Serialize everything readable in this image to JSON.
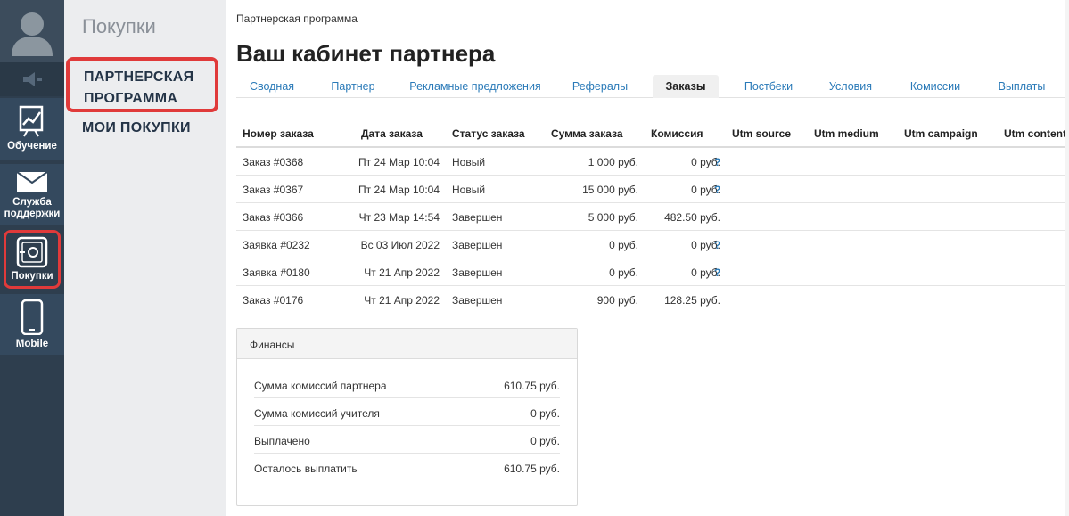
{
  "rail": {
    "learning_label": "Обучение",
    "support_label_1": "Служба",
    "support_label_2": "поддержки",
    "purchases_label": "Покупки",
    "mobile_label": "Mobile"
  },
  "subnav": {
    "title": "Покупки",
    "partner_line1": "ПАРТНЕРСКАЯ",
    "partner_line2": "ПРОГРАММА",
    "my_purchases": "МОИ ПОКУПКИ"
  },
  "main": {
    "breadcrumb": "Партнерская программа",
    "title": "Ваш кабинет партнера",
    "tabs": [
      {
        "label": "Сводная",
        "active": false
      },
      {
        "label": "Партнер",
        "active": false
      },
      {
        "label": "Рекламные предложения",
        "active": false
      },
      {
        "label": "Рефералы",
        "active": false
      },
      {
        "label": "Заказы",
        "active": true
      },
      {
        "label": "Постбеки",
        "active": false
      },
      {
        "label": "Условия",
        "active": false
      },
      {
        "label": "Комиссии",
        "active": false
      },
      {
        "label": "Выплаты",
        "active": false
      }
    ]
  },
  "orders": {
    "columns": [
      "Номер заказа",
      "Дата заказа",
      "Статус заказа",
      "Сумма заказа",
      "Комиссия",
      "Utm source",
      "Utm medium",
      "Utm campaign",
      "Utm content"
    ],
    "rows": [
      {
        "number": "Заказ #0368",
        "date": "Пт 24 Мар 10:04",
        "status": "Новый",
        "sum": "1 000 руб.",
        "commission": "0 руб.",
        "help": "?"
      },
      {
        "number": "Заказ #0367",
        "date": "Пт 24 Мар 10:04",
        "status": "Новый",
        "sum": "15 000 руб.",
        "commission": "0 руб.",
        "help": "?"
      },
      {
        "number": "Заказ #0366",
        "date": "Чт 23 Мар 14:54",
        "status": "Завершен",
        "sum": "5 000 руб.",
        "commission": "482.50 руб.",
        "help": ""
      },
      {
        "number": "Заявка #0232",
        "date": "Вс 03 Июл 2022",
        "status": "Завершен",
        "sum": "0 руб.",
        "commission": "0 руб.",
        "help": "?"
      },
      {
        "number": "Заявка #0180",
        "date": "Чт 21 Апр 2022",
        "status": "Завершен",
        "sum": "0 руб.",
        "commission": "0 руб.",
        "help": "?"
      },
      {
        "number": "Заказ #0176",
        "date": "Чт 21 Апр 2022",
        "status": "Завершен",
        "sum": "900 руб.",
        "commission": "128.25 руб.",
        "help": ""
      }
    ]
  },
  "finance": {
    "title": "Финансы",
    "rows": [
      {
        "label": "Сумма комиссий партнера",
        "value": "610.75 руб."
      },
      {
        "label": "Сумма комиссий учителя",
        "value": "0 руб."
      },
      {
        "label": "Выплачено",
        "value": "0 руб."
      },
      {
        "label": "Осталось выплатить",
        "value": "610.75 руб."
      }
    ]
  },
  "colors": {
    "rail_bg": "#2e3e4e",
    "subnav_bg": "#ecedef",
    "highlight_red": "#e03a3a",
    "link_blue": "#2a7ab8"
  }
}
